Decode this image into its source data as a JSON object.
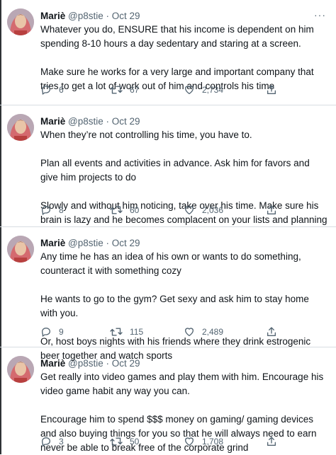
{
  "tweets": [
    {
      "name": "Mariè",
      "handle": "@p8stie",
      "date": "Oct 29",
      "paragraphs": [
        "Whatever you do, ENSURE that his income is dependent on him spending 8-10 hours a day sedentary and staring at a screen.",
        "Make sure he works for a very large and important company that tries to get a lot of work out of him and controls his time"
      ],
      "replies": "6",
      "retweets": "67",
      "likes": "2,734"
    },
    {
      "name": "Mariè",
      "handle": "@p8stie",
      "date": "Oct 29",
      "paragraphs": [
        "When they’re not controlling his time, you have to.",
        "Plan all events and activities in advance. Ask him for favors and give him projects to do",
        "Slowly and without him noticing, take over his time. Make sure his brain is lazy and he becomes complacent on your lists and planning"
      ],
      "replies": "8",
      "retweets": "60",
      "likes": "2,036"
    },
    {
      "name": "Mariè",
      "handle": "@p8stie",
      "date": "Oct 29",
      "paragraphs": [
        "Any time he has an idea of his own or wants to do something, counteract it with something cozy",
        "He wants to go to the gym? Get sexy and ask him to stay home with you.",
        "Or, host boys nights with his friends where they drink estrogenic beer together and watch sports"
      ],
      "replies": "9",
      "retweets": "115",
      "likes": "2,489"
    },
    {
      "name": "Mariè",
      "handle": "@p8stie",
      "date": "Oct 29",
      "paragraphs": [
        "Get really into video games and play them with him. Encourage his video game habit any way you can.",
        "Encourage him to spend $$$ money on gaming/ gaming devices and also buying things for you so that he will always need to earn never be able to break free of the corporate grind"
      ],
      "replies": "3",
      "retweets": "50",
      "likes": "1,708"
    }
  ],
  "meta_separator": " · ",
  "more_label": "···",
  "icons": {
    "reply": "reply-icon",
    "retweet": "retweet-icon",
    "like": "heart-icon",
    "share": "share-icon",
    "more": "more-icon"
  },
  "colors": {
    "text": "#0f1419",
    "muted": "#536471",
    "divider": "#d8dde2"
  }
}
